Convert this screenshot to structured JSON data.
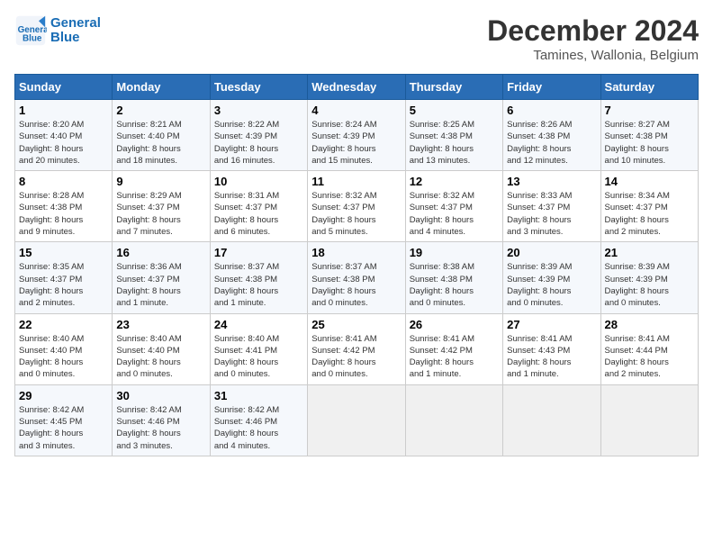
{
  "header": {
    "logo_line1": "General",
    "logo_line2": "Blue",
    "title": "December 2024",
    "subtitle": "Tamines, Wallonia, Belgium"
  },
  "columns": [
    "Sunday",
    "Monday",
    "Tuesday",
    "Wednesday",
    "Thursday",
    "Friday",
    "Saturday"
  ],
  "weeks": [
    [
      {
        "day": "1",
        "lines": [
          "Sunrise: 8:20 AM",
          "Sunset: 4:40 PM",
          "Daylight: 8 hours",
          "and 20 minutes."
        ]
      },
      {
        "day": "2",
        "lines": [
          "Sunrise: 8:21 AM",
          "Sunset: 4:40 PM",
          "Daylight: 8 hours",
          "and 18 minutes."
        ]
      },
      {
        "day": "3",
        "lines": [
          "Sunrise: 8:22 AM",
          "Sunset: 4:39 PM",
          "Daylight: 8 hours",
          "and 16 minutes."
        ]
      },
      {
        "day": "4",
        "lines": [
          "Sunrise: 8:24 AM",
          "Sunset: 4:39 PM",
          "Daylight: 8 hours",
          "and 15 minutes."
        ]
      },
      {
        "day": "5",
        "lines": [
          "Sunrise: 8:25 AM",
          "Sunset: 4:38 PM",
          "Daylight: 8 hours",
          "and 13 minutes."
        ]
      },
      {
        "day": "6",
        "lines": [
          "Sunrise: 8:26 AM",
          "Sunset: 4:38 PM",
          "Daylight: 8 hours",
          "and 12 minutes."
        ]
      },
      {
        "day": "7",
        "lines": [
          "Sunrise: 8:27 AM",
          "Sunset: 4:38 PM",
          "Daylight: 8 hours",
          "and 10 minutes."
        ]
      }
    ],
    [
      {
        "day": "8",
        "lines": [
          "Sunrise: 8:28 AM",
          "Sunset: 4:38 PM",
          "Daylight: 8 hours",
          "and 9 minutes."
        ]
      },
      {
        "day": "9",
        "lines": [
          "Sunrise: 8:29 AM",
          "Sunset: 4:37 PM",
          "Daylight: 8 hours",
          "and 7 minutes."
        ]
      },
      {
        "day": "10",
        "lines": [
          "Sunrise: 8:31 AM",
          "Sunset: 4:37 PM",
          "Daylight: 8 hours",
          "and 6 minutes."
        ]
      },
      {
        "day": "11",
        "lines": [
          "Sunrise: 8:32 AM",
          "Sunset: 4:37 PM",
          "Daylight: 8 hours",
          "and 5 minutes."
        ]
      },
      {
        "day": "12",
        "lines": [
          "Sunrise: 8:32 AM",
          "Sunset: 4:37 PM",
          "Daylight: 8 hours",
          "and 4 minutes."
        ]
      },
      {
        "day": "13",
        "lines": [
          "Sunrise: 8:33 AM",
          "Sunset: 4:37 PM",
          "Daylight: 8 hours",
          "and 3 minutes."
        ]
      },
      {
        "day": "14",
        "lines": [
          "Sunrise: 8:34 AM",
          "Sunset: 4:37 PM",
          "Daylight: 8 hours",
          "and 2 minutes."
        ]
      }
    ],
    [
      {
        "day": "15",
        "lines": [
          "Sunrise: 8:35 AM",
          "Sunset: 4:37 PM",
          "Daylight: 8 hours",
          "and 2 minutes."
        ]
      },
      {
        "day": "16",
        "lines": [
          "Sunrise: 8:36 AM",
          "Sunset: 4:37 PM",
          "Daylight: 8 hours",
          "and 1 minute."
        ]
      },
      {
        "day": "17",
        "lines": [
          "Sunrise: 8:37 AM",
          "Sunset: 4:38 PM",
          "Daylight: 8 hours",
          "and 1 minute."
        ]
      },
      {
        "day": "18",
        "lines": [
          "Sunrise: 8:37 AM",
          "Sunset: 4:38 PM",
          "Daylight: 8 hours",
          "and 0 minutes."
        ]
      },
      {
        "day": "19",
        "lines": [
          "Sunrise: 8:38 AM",
          "Sunset: 4:38 PM",
          "Daylight: 8 hours",
          "and 0 minutes."
        ]
      },
      {
        "day": "20",
        "lines": [
          "Sunrise: 8:39 AM",
          "Sunset: 4:39 PM",
          "Daylight: 8 hours",
          "and 0 minutes."
        ]
      },
      {
        "day": "21",
        "lines": [
          "Sunrise: 8:39 AM",
          "Sunset: 4:39 PM",
          "Daylight: 8 hours",
          "and 0 minutes."
        ]
      }
    ],
    [
      {
        "day": "22",
        "lines": [
          "Sunrise: 8:40 AM",
          "Sunset: 4:40 PM",
          "Daylight: 8 hours",
          "and 0 minutes."
        ]
      },
      {
        "day": "23",
        "lines": [
          "Sunrise: 8:40 AM",
          "Sunset: 4:40 PM",
          "Daylight: 8 hours",
          "and 0 minutes."
        ]
      },
      {
        "day": "24",
        "lines": [
          "Sunrise: 8:40 AM",
          "Sunset: 4:41 PM",
          "Daylight: 8 hours",
          "and 0 minutes."
        ]
      },
      {
        "day": "25",
        "lines": [
          "Sunrise: 8:41 AM",
          "Sunset: 4:42 PM",
          "Daylight: 8 hours",
          "and 0 minutes."
        ]
      },
      {
        "day": "26",
        "lines": [
          "Sunrise: 8:41 AM",
          "Sunset: 4:42 PM",
          "Daylight: 8 hours",
          "and 1 minute."
        ]
      },
      {
        "day": "27",
        "lines": [
          "Sunrise: 8:41 AM",
          "Sunset: 4:43 PM",
          "Daylight: 8 hours",
          "and 1 minute."
        ]
      },
      {
        "day": "28",
        "lines": [
          "Sunrise: 8:41 AM",
          "Sunset: 4:44 PM",
          "Daylight: 8 hours",
          "and 2 minutes."
        ]
      }
    ],
    [
      {
        "day": "29",
        "lines": [
          "Sunrise: 8:42 AM",
          "Sunset: 4:45 PM",
          "Daylight: 8 hours",
          "and 3 minutes."
        ]
      },
      {
        "day": "30",
        "lines": [
          "Sunrise: 8:42 AM",
          "Sunset: 4:46 PM",
          "Daylight: 8 hours",
          "and 3 minutes."
        ]
      },
      {
        "day": "31",
        "lines": [
          "Sunrise: 8:42 AM",
          "Sunset: 4:46 PM",
          "Daylight: 8 hours",
          "and 4 minutes."
        ]
      },
      null,
      null,
      null,
      null
    ]
  ]
}
